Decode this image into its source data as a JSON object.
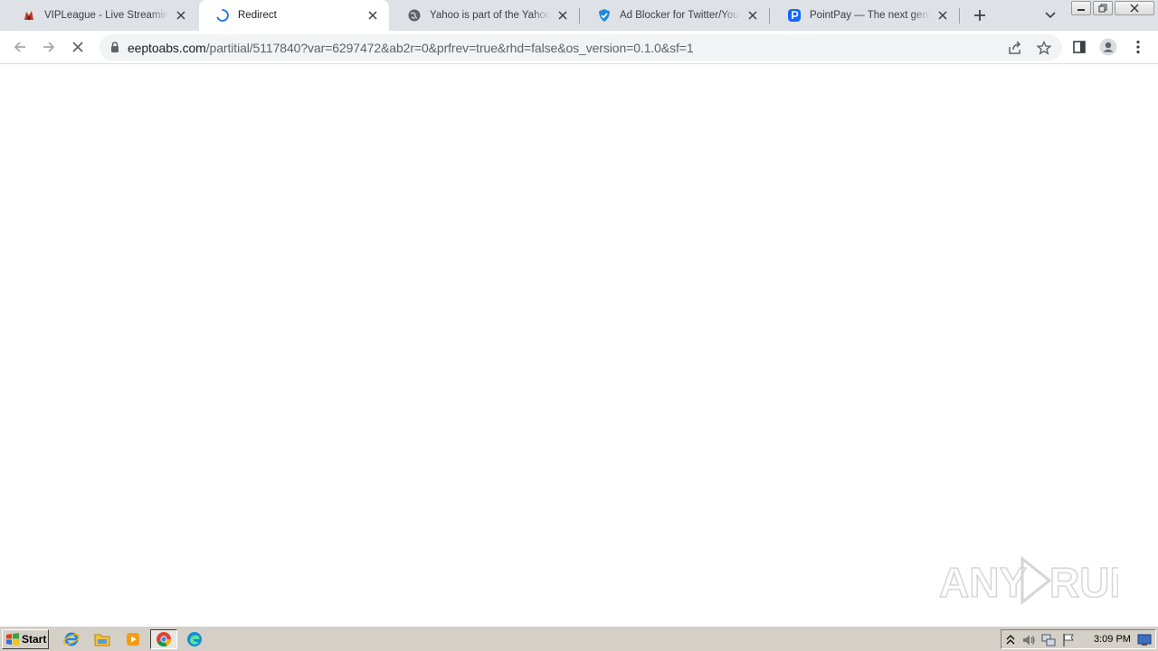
{
  "browser": {
    "tabs": [
      {
        "title": "VIPLeague - Live Streaming - VIPLeague",
        "favicon": "vipleague-icon",
        "active": false
      },
      {
        "title": "Redirect",
        "favicon": "loading-spinner-icon",
        "active": true
      },
      {
        "title": "Yahoo is part of the Yahoo family of brands",
        "favicon": "globe-icon",
        "active": false
      },
      {
        "title": "Ad Blocker for Twitter/Youtube",
        "favicon": "shield-icon",
        "active": false
      },
      {
        "title": "PointPay — The next generation",
        "favicon": "pointpay-icon",
        "active": false
      }
    ],
    "address_bar": {
      "domain": "eeptoabs.com",
      "path": "/partitial/5117840?var=6297472&ab2r=0&prfrev=true&rhd=false&os_version=0.1.0&sf=1"
    },
    "loading": true
  },
  "watermark": {
    "text_left": "ANY",
    "text_right": "RUN"
  },
  "taskbar": {
    "start_label": "Start",
    "apps": [
      "internet-explorer-icon",
      "file-explorer-icon",
      "media-player-icon",
      "chrome-icon",
      "edge-icon"
    ],
    "clock": "3:09 PM"
  },
  "colors": {
    "tabstrip": "#dee1e6",
    "omnibox": "#f1f3f4",
    "taskbar": "#d4d0c8",
    "accent_blue": "#1a73e8"
  }
}
